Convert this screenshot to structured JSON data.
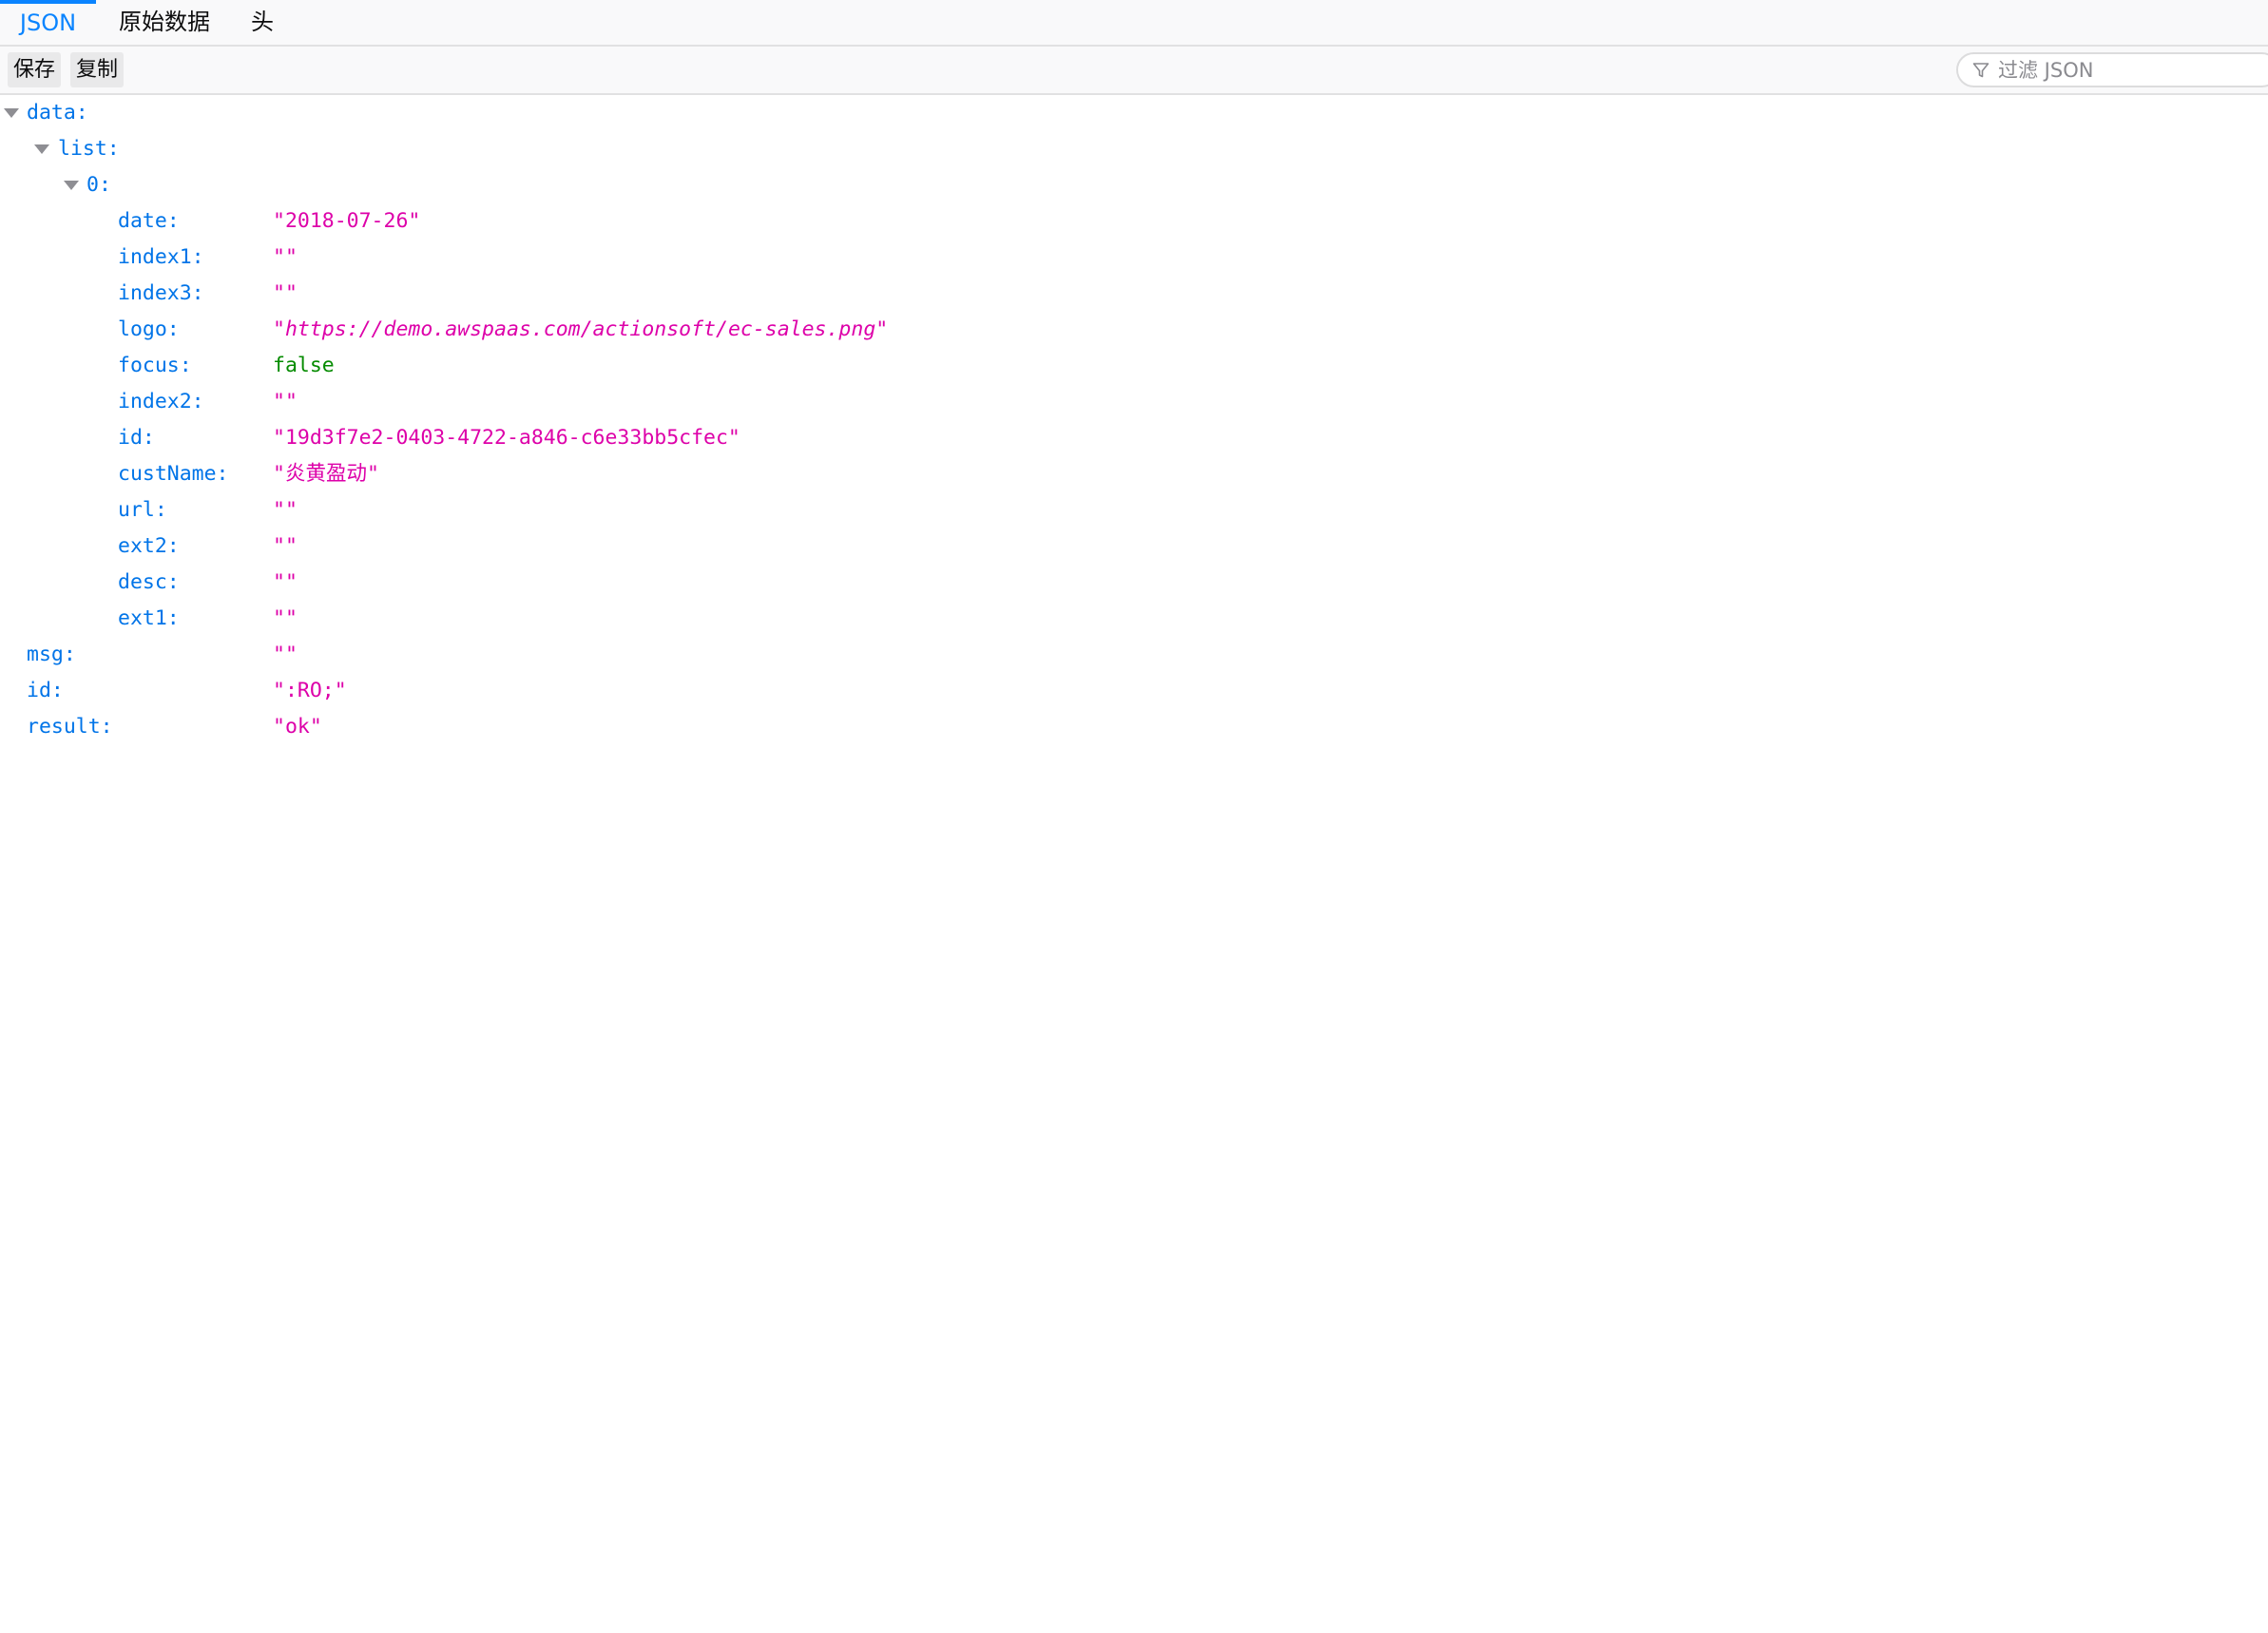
{
  "tabs": {
    "json": "JSON",
    "raw": "原始数据",
    "headers": "头"
  },
  "toolbar": {
    "save_label": "保存",
    "copy_label": "复制",
    "filter_placeholder": "过滤 JSON",
    "filter_value": ""
  },
  "colors": {
    "accent": "#0a84ff",
    "key": "#0074e8",
    "string": "#dd00a9",
    "boolean": "#058b00"
  },
  "tree": {
    "data_key": "data:",
    "list_key": "list:",
    "item_key": "0:",
    "item": {
      "date": {
        "key": "date:",
        "value": "\"2018-07-26\""
      },
      "index1": {
        "key": "index1:",
        "value": "\"\""
      },
      "index3": {
        "key": "index3:",
        "value": "\"\""
      },
      "logo": {
        "key": "logo:",
        "quote_open": "\"",
        "value": "https://demo.awspaas.com/actionsoft/ec-sales.png",
        "quote_close": "\""
      },
      "focus": {
        "key": "focus:",
        "value": "false"
      },
      "index2": {
        "key": "index2:",
        "value": "\"\""
      },
      "id": {
        "key": "id:",
        "value": "\"19d3f7e2-0403-4722-a846-c6e33bb5cfec\""
      },
      "custName": {
        "key": "custName:",
        "value": "\"炎黄盈动\""
      },
      "url": {
        "key": "url:",
        "value": "\"\""
      },
      "ext2": {
        "key": "ext2:",
        "value": "\"\""
      },
      "desc": {
        "key": "desc:",
        "value": "\"\""
      },
      "ext1": {
        "key": "ext1:",
        "value": "\"\""
      }
    },
    "msg": {
      "key": "msg:",
      "value": "\"\""
    },
    "id": {
      "key": "id:",
      "value": "\":RO;\""
    },
    "result": {
      "key": "result:",
      "value": "\"ok\""
    }
  }
}
